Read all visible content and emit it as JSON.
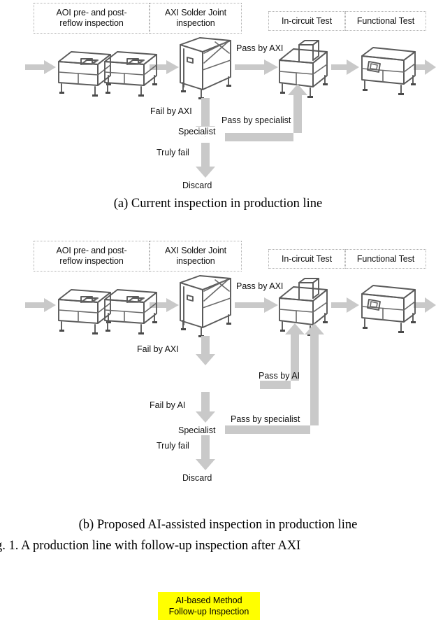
{
  "figure": {
    "caption_a": "(a) Current inspection in production line",
    "caption_b": "(b) Proposed AI-assisted inspection in production line",
    "figure_caption": "g. 1.   A production line with follow-up inspection after AXI",
    "highlight_color": "#FFFF00",
    "arrow_color": "#C9C9C9",
    "machine_stroke_color": "#5A5A5A"
  },
  "panel_a": {
    "boxes": [
      {
        "id": "aoi",
        "label": "AOI pre- and post-\nreflow inspection",
        "line1": "AOI pre- and post-",
        "line2": "reflow inspection"
      },
      {
        "id": "axi",
        "label": "AXI Solder Joint\ninspection",
        "line1": "AXI Solder Joint",
        "line2": "inspection"
      },
      {
        "id": "ict",
        "label": "In-circuit Test",
        "line1": "In-circuit Test",
        "line2": ""
      },
      {
        "id": "fct",
        "label": "Functional Test",
        "line1": "Functional Test",
        "line2": ""
      }
    ],
    "flow_labels": {
      "pass_by_axi": "Pass by AXI",
      "fail_by_axi": "Fail by AXI",
      "pass_by_specialist": "Pass by specialist",
      "specialist": "Specialist",
      "truly_fail": "Truly fail",
      "discard": "Discard"
    }
  },
  "panel_b": {
    "boxes": [
      {
        "id": "aoi",
        "line1": "AOI pre- and post-",
        "line2": "reflow inspection"
      },
      {
        "id": "axi",
        "line1": "AXI Solder Joint",
        "line2": "inspection"
      },
      {
        "id": "ict",
        "line1": "In-circuit Test",
        "line2": ""
      },
      {
        "id": "fct",
        "line1": "Functional Test",
        "line2": ""
      }
    ],
    "ai_box": {
      "line1": "AI-based Method",
      "line2": "Follow-up Inspection"
    },
    "flow_labels": {
      "pass_by_axi": "Pass by AXI",
      "fail_by_axi": "Fail by AXI",
      "pass_by_ai": "Pass by AI",
      "fail_by_ai": "Fail by AI",
      "pass_by_specialist": "Pass by specialist",
      "specialist": "Specialist",
      "truly_fail": "Truly fail",
      "discard": "Discard"
    }
  }
}
